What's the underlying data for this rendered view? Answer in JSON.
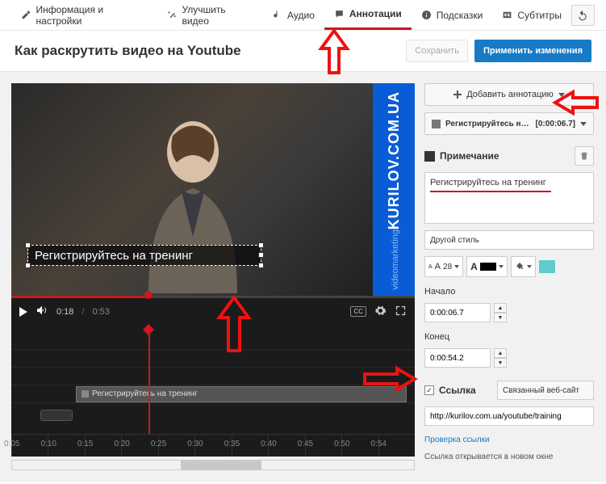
{
  "tabs": {
    "info": "Информация и настройки",
    "enhance": "Улучшить видео",
    "audio": "Аудио",
    "annotations": "Аннотации",
    "cards": "Подсказки",
    "subtitles": "Субтитры"
  },
  "title": "Как раскрутить видео на Youtube",
  "actions": {
    "save": "Сохранить",
    "apply": "Применить изменения"
  },
  "video": {
    "banner_main": "KURILOV.COM.UA",
    "banner_sub": "videomarketing",
    "annotation_text": "Регистрируйтесь на тренинг",
    "current_time": "0:18",
    "duration": "0:53",
    "progress_pct": 34
  },
  "timeline": {
    "annotation_label": "Регистрируйтесь на тренинг",
    "ticks": [
      "0:05",
      "0:10",
      "0:15",
      "0:20",
      "0:25",
      "0:30",
      "0:35",
      "0:40",
      "0:45",
      "0:50",
      "0:54"
    ],
    "playhead_pct": 34,
    "annot_left_pct": 16,
    "annot_width_pct": 84
  },
  "panel": {
    "add_annotation": "Добавить аннотацию",
    "item_text": "Регистрируйтесь на трен...",
    "item_time": "[0:00:06.7]",
    "section_note": "Примечание",
    "text_value": "Регистрируйтесь на тренинг",
    "style_select": "Другой стиль",
    "font_size": "28",
    "start_label": "Начало",
    "start_value": "0:00:06.7",
    "end_label": "Конец",
    "end_value": "0:00:54.2",
    "link_label": "Ссылка",
    "link_type": "Связанный веб-сайт",
    "url": "http://kurilov.com.ua/youtube/training",
    "check_link": "Проверка ссылки",
    "link_note": "Ссылка открывается в новом окне"
  }
}
